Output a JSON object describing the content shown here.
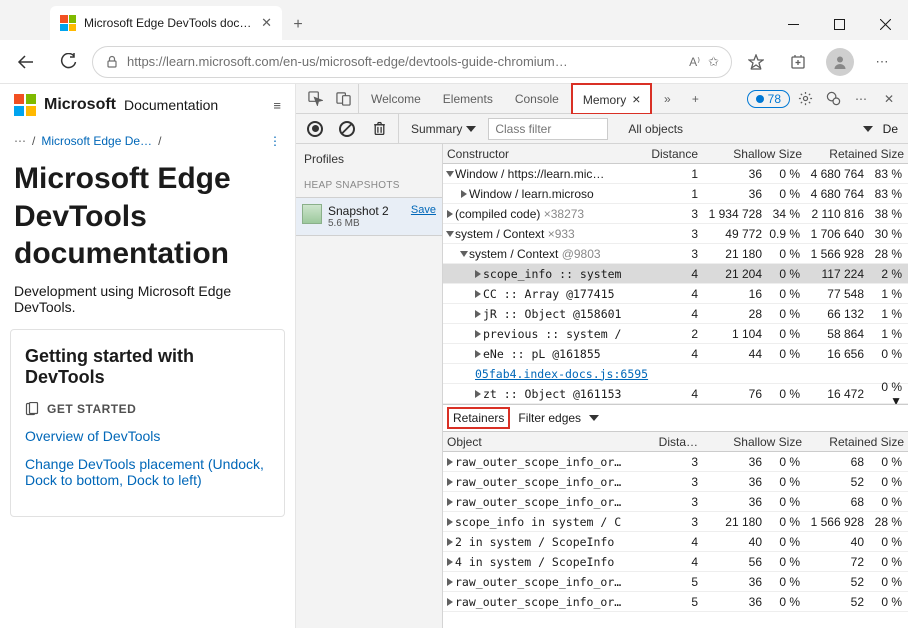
{
  "window": {
    "tab_title": "Microsoft Edge DevTools docum…"
  },
  "url": "https://learn.microsoft.com/en-us/microsoft-edge/devtools-guide-chromium…",
  "badge_count": "78",
  "docs": {
    "brand": "Microsoft",
    "section": "Documentation",
    "crumb_parent": "Microsoft Edge De…",
    "title": "Microsoft Edge DevTools documentation",
    "lead": "Development using Microsoft Edge DevTools.",
    "card_title": "Getting started with DevTools",
    "card_subhead": "GET STARTED",
    "link_overview": "Overview of DevTools",
    "link_placement": "Change DevTools placement (Undock, Dock to bottom, Dock to left)"
  },
  "dt": {
    "tabs": {
      "welcome": "Welcome",
      "elements": "Elements",
      "console": "Console",
      "memory": "Memory"
    },
    "summary_label": "Summary",
    "filter_placeholder": "Class filter",
    "objects_scope": "All objects",
    "de_cut": "De",
    "profiles": "Profiles",
    "heap_label": "HEAP SNAPSHOTS",
    "snap_name": "Snapshot 2",
    "snap_save": "Save",
    "snap_size": "5.6 MB",
    "headers": {
      "constructor": "Constructor",
      "distance": "Distance",
      "shallow": "Shallow Size",
      "retained": "Retained Size",
      "object": "Object",
      "dista": "Dista…"
    },
    "rows": [
      {
        "ind": 0,
        "open": true,
        "name": "Window / https://learn.mic…",
        "name_plain": true,
        "dist": "1",
        "sv": "36",
        "sp": "0 %",
        "rv": "4 680 764",
        "rp": "83 %"
      },
      {
        "ind": 1,
        "open": false,
        "name": "Window / learn.microso",
        "name_plain": true,
        "dist": "1",
        "sv": "36",
        "sp": "0 %",
        "rv": "4 680 764",
        "rp": "83 %"
      },
      {
        "ind": 0,
        "open": false,
        "name": "(compiled code) ×38273",
        "muted_tail": "×38273",
        "dist": "3",
        "sv": "1 934 728",
        "sp": "34 %",
        "rv": "2 110 816",
        "rp": "38 %"
      },
      {
        "ind": 0,
        "open": true,
        "name": "system / Context ×933",
        "muted_tail": "×933",
        "dist": "3",
        "sv": "49 772",
        "sp": "0.9 %",
        "rv": "1 706 640",
        "rp": "30 %"
      },
      {
        "ind": 1,
        "open": true,
        "name": "system / Context @9803",
        "muted_tail": "@9803",
        "dist": "3",
        "sv": "21 180",
        "sp": "0 %",
        "rv": "1 566 928",
        "rp": "28 %"
      },
      {
        "ind": 2,
        "open": false,
        "name": "scope_info :: system",
        "mono": true,
        "selected": true,
        "dist": "4",
        "sv": "21 204",
        "sp": "0 %",
        "rv": "117 224",
        "rp": "2 %"
      },
      {
        "ind": 2,
        "open": false,
        "name": "CC :: Array @177415",
        "mono": true,
        "dist": "4",
        "sv": "16",
        "sp": "0 %",
        "rv": "77 548",
        "rp": "1 %"
      },
      {
        "ind": 2,
        "open": false,
        "name": "jR :: Object @158601",
        "mono": true,
        "dist": "4",
        "sv": "28",
        "sp": "0 %",
        "rv": "66 132",
        "rp": "1 %"
      },
      {
        "ind": 2,
        "open": false,
        "name": "previous :: system /",
        "mono": true,
        "dist": "2",
        "sv": "1 104",
        "sp": "0 %",
        "rv": "58 864",
        "rp": "1 %"
      },
      {
        "ind": 2,
        "open": false,
        "name": "eNe :: pL @161855",
        "mono": true,
        "dist": "4",
        "sv": "44",
        "sp": "0 %",
        "rv": "16 656",
        "rp": "0 %"
      },
      {
        "ind": 2,
        "open": null,
        "link": "05fab4.index-docs.js:6595"
      },
      {
        "ind": 2,
        "open": false,
        "name": "zt :: Object @161153",
        "mono": true,
        "dist": "4",
        "sv": "76",
        "sp": "0 %",
        "rv": "16 472",
        "rp": "0 % ▼"
      }
    ],
    "retainers_label": "Retainers",
    "filter_edges": "Filter edges",
    "retain_rows": [
      {
        "name": "raw_outer_scope_info_or…",
        "dist": "3",
        "sv": "36",
        "sp": "0 %",
        "rv": "68",
        "rp": "0 %"
      },
      {
        "name": "raw_outer_scope_info_or…",
        "dist": "3",
        "sv": "36",
        "sp": "0 %",
        "rv": "52",
        "rp": "0 %"
      },
      {
        "name": "raw_outer_scope_info_or…",
        "dist": "3",
        "sv": "36",
        "sp": "0 %",
        "rv": "68",
        "rp": "0 %"
      },
      {
        "name": "scope_info in system / C",
        "dist": "3",
        "sv": "21 180",
        "sp": "0 %",
        "rv": "1 566 928",
        "rp": "28 %"
      },
      {
        "name": "2 in system / ScopeInfo",
        "dist": "4",
        "sv": "40",
        "sp": "0 %",
        "rv": "40",
        "rp": "0 %"
      },
      {
        "name": "4 in system / ScopeInfo",
        "dist": "4",
        "sv": "56",
        "sp": "0 %",
        "rv": "72",
        "rp": "0 %"
      },
      {
        "name": "raw_outer_scope_info_or…",
        "dist": "5",
        "sv": "36",
        "sp": "0 %",
        "rv": "52",
        "rp": "0 %"
      },
      {
        "name": "raw_outer_scope_info_or…",
        "dist": "5",
        "sv": "36",
        "sp": "0 %",
        "rv": "52",
        "rp": "0 %"
      }
    ]
  }
}
